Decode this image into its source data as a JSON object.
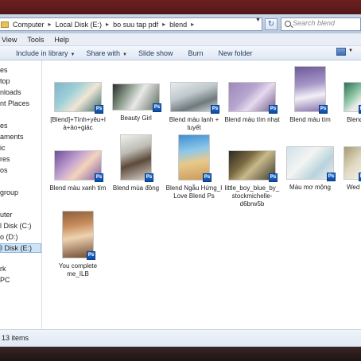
{
  "address": {
    "crumbs": [
      "Computer",
      "Local Disk (E:)",
      "bo suu tap pdf",
      "blend"
    ],
    "search_placeholder": "Search blend"
  },
  "menu": [
    "View",
    "Tools",
    "Help"
  ],
  "toolbar": {
    "include_library": "Include in library",
    "share_with": "Share with",
    "slide_show": "Slide show",
    "burn": "Burn",
    "new_folder": "New folder"
  },
  "nav": [
    "es",
    "top",
    "nloads",
    "nt Places",
    "es",
    "aments",
    "ic",
    "res",
    "os",
    "group",
    "uter",
    "l Disk (C:)",
    "o (D:)",
    "l Disk (E:)",
    "rk",
    "PC"
  ],
  "files": [
    {
      "name": "[Blend]+Tình+yêu+là+ảo+giác"
    },
    {
      "name": "Beauty Girl"
    },
    {
      "name": "Blend màu lạnh + tuyết"
    },
    {
      "name": "Blend màu tím nhạt"
    },
    {
      "name": "Blend màu tím"
    },
    {
      "name": "Blend"
    },
    {
      "name": "Blend màu xanh tím"
    },
    {
      "name": "Blend mùa đông"
    },
    {
      "name": "Blend Ngẫu Hứng_I Love Blend Ps"
    },
    {
      "name": "little_boy_blue_by_stockmichelle-d6brw5b"
    },
    {
      "name": "Màu mơ mộng"
    },
    {
      "name": "Wed"
    },
    {
      "name": "You complete me_ILB"
    }
  ],
  "status": {
    "count": "13 items"
  },
  "icons": {
    "badge": "Ps"
  }
}
